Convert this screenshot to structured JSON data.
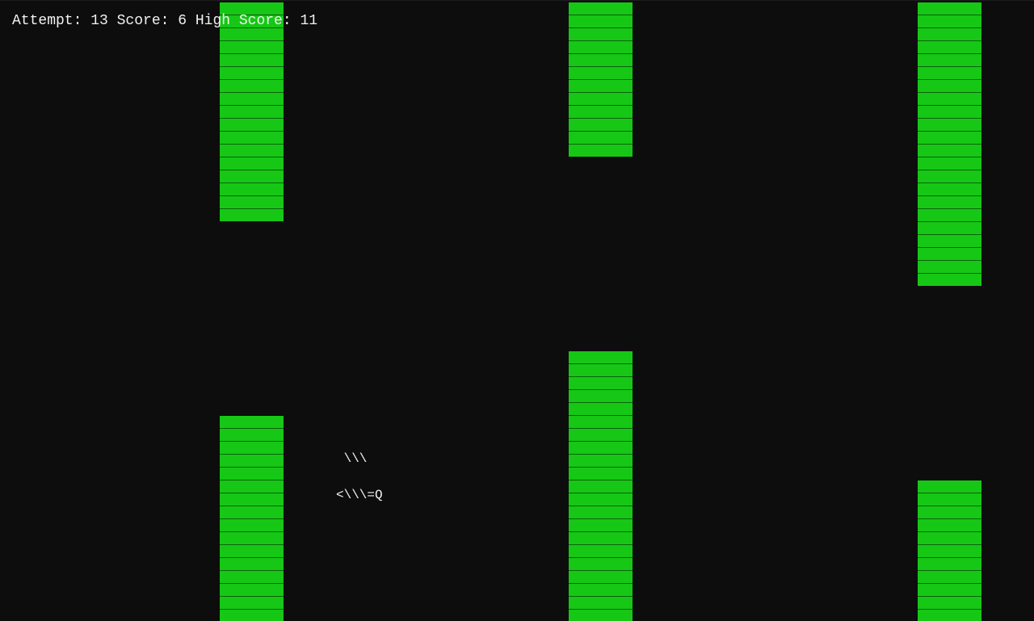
{
  "hud": {
    "text": "Attempt: 13 Score: 6 High Score: 11",
    "attempt": 13,
    "score": 6,
    "high_score": 11
  },
  "player": {
    "sprite_line_1": " \\\\\\",
    "sprite_line_2": "<\\\\\\=Q"
  },
  "pipes": [
    {
      "name": "pipe-col-1"
    },
    {
      "name": "pipe-col-2"
    },
    {
      "name": "pipe-col-3"
    }
  ],
  "colors": {
    "background": "#0d0d0d",
    "pipe_fill": "#16c716",
    "pipe_line": "#0b630b",
    "text": "#f2f2f2"
  }
}
